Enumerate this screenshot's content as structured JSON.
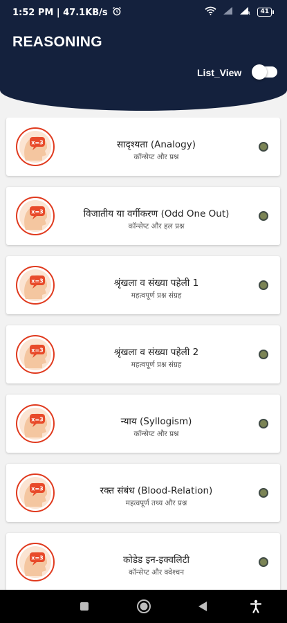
{
  "status_bar": {
    "time_speed": "1:52 PM | 47.1KB/s",
    "battery": "41",
    "icons": [
      "alarm-icon",
      "wifi-icon",
      "signal-icon",
      "signal-r-icon",
      "battery-icon"
    ]
  },
  "header": {
    "title": "REASONING",
    "list_view_label": "List_View",
    "list_view_enabled": false
  },
  "cards": [
    {
      "title": "सादृश्यता (Analogy)",
      "subtitle": "कॉन्सेप्ट और प्रश्न"
    },
    {
      "title": "विजातीय या वर्गीकरण (Odd One Out)",
      "subtitle": "कॉन्सेप्ट और हल प्रश्न"
    },
    {
      "title": "श्रृंखला व संख्या पहेली 1",
      "subtitle": "महत्वपूर्ण प्रश्न संग्रह"
    },
    {
      "title": "श्रृंखला व संख्या पहेली 2",
      "subtitle": "महत्वपूर्ण प्रश्न संग्रह"
    },
    {
      "title": "न्याय (Syllogism)",
      "subtitle": "कॉन्सेप्ट और प्रश्न"
    },
    {
      "title": "रक्त संबंध (Blood-Relation)",
      "subtitle": "महत्वपूर्ण तथ्य और प्रश्न"
    },
    {
      "title": "कोडेड इन-इक्वलिटी",
      "subtitle": "कॉन्सेप्ट और क्वेश्चन"
    }
  ],
  "card_icon": {
    "name": "brain-math-icon",
    "text": "x=3"
  },
  "colors": {
    "header_bg": "#14213d",
    "page_bg": "#f2f2f2",
    "icon_ring": "#e03a1e",
    "icon_face": "#f4c6a0",
    "dot": "#7b8455"
  },
  "nav_bar": {
    "icons": [
      "recents-square-icon",
      "home-circle-icon",
      "back-triangle-icon",
      "accessibility-icon"
    ]
  }
}
